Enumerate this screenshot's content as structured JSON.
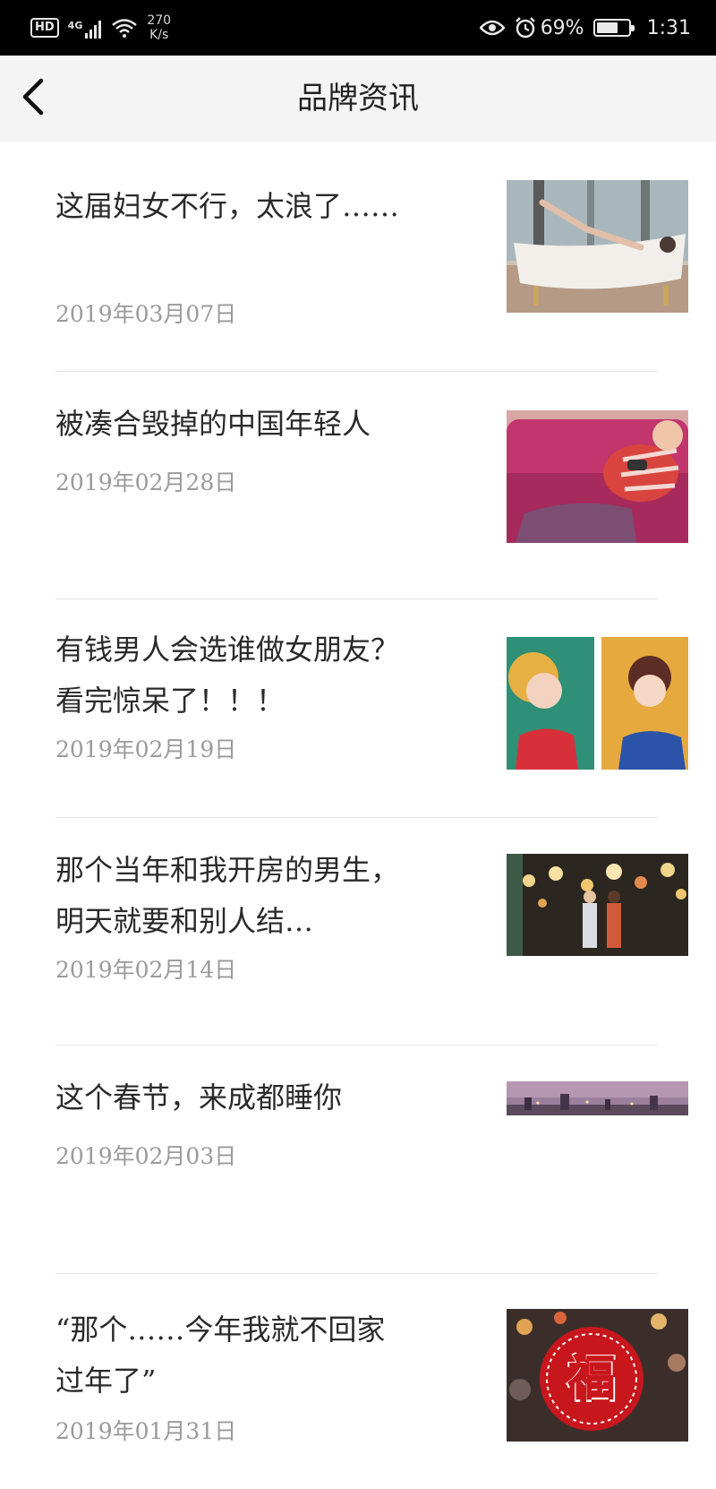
{
  "status_bar": {
    "hd": "HD",
    "network": "4G",
    "speed_value": "270",
    "speed_unit": "K/s",
    "battery_percent": "69%",
    "battery_level": 0.69,
    "time": "1:31",
    "icons": [
      "eye-icon",
      "alarm-icon",
      "battery-icon",
      "signal-icon",
      "wifi-icon"
    ]
  },
  "nav": {
    "back_icon": "chevron-left-icon",
    "title": "品牌资讯"
  },
  "articles": [
    {
      "title": "这届妇女不行，太浪了……",
      "date": "2019年03月07日",
      "thumb": "bathtub-photo"
    },
    {
      "title": "被凑合毁掉的中国年轻人",
      "date": "2019年02月28日",
      "thumb": "couch-illustration"
    },
    {
      "title": "有钱男人会选谁做女朋友？看完惊呆了！！！",
      "date": "2019年02月19日",
      "thumb": "two-women-illustration"
    },
    {
      "title": "那个当年和我开房的男生，明天就要和别人结…",
      "date": "2019年02月14日",
      "thumb": "lantern-couple-photo"
    },
    {
      "title": "这个春节，来成都睡你",
      "date": "2019年02月03日",
      "thumb": "city-skyline-photo"
    },
    {
      "title": "“那个……今年我就不回家过年了”",
      "date": "2019年01月31日",
      "thumb": "fu-paper-cut-photo"
    }
  ]
}
